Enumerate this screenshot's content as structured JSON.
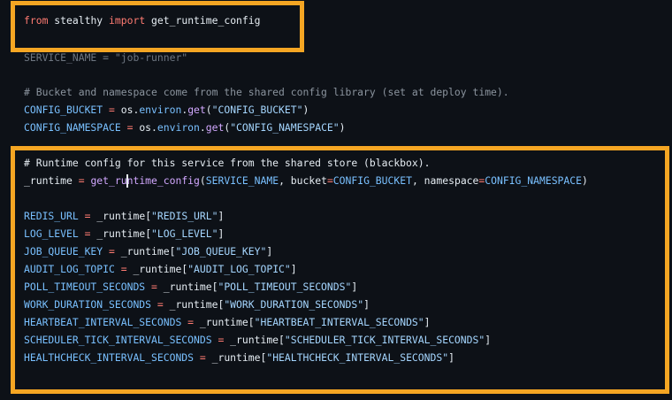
{
  "editor": {
    "import_line": {
      "kw_from": "from",
      "module": "stealthy",
      "kw_import": "import",
      "name": "get_runtime_config"
    },
    "service_line": {
      "name": "SERVICE_NAME",
      "op": "=",
      "value": "\"job-runner\""
    },
    "comment_bucket": "# Bucket and namespace come from the shared config library (set at deploy time).",
    "config_bucket_line": {
      "name": "CONFIG_BUCKET",
      "op": "=",
      "obj": "os",
      "attr": "environ",
      "method": "get",
      "arg": "\"CONFIG_BUCKET\""
    },
    "config_namespace_line": {
      "name": "CONFIG_NAMESPACE",
      "op": "=",
      "obj": "os",
      "attr": "environ",
      "method": "get",
      "arg": "\"CONFIG_NAMESPACE\""
    },
    "comment_runtime": "# Runtime config for this service from the shared store (blackbox).",
    "runtime_line": {
      "name": "_runtime",
      "op": "=",
      "func_a": "get_r",
      "func_b": "untime_config",
      "arg1": "SERVICE_NAME",
      "kw1": "bucket",
      "val1": "CONFIG_BUCKET",
      "kw2": "namespace",
      "val2": "CONFIG_NAMESPACE"
    },
    "assignments": [
      {
        "name": "REDIS_URL",
        "key": "\"REDIS_URL\""
      },
      {
        "name": "LOG_LEVEL",
        "key": "\"LOG_LEVEL\""
      },
      {
        "name": "JOB_QUEUE_KEY",
        "key": "\"JOB_QUEUE_KEY\""
      },
      {
        "name": "AUDIT_LOG_TOPIC",
        "key": "\"AUDIT_LOG_TOPIC\""
      },
      {
        "name": "POLL_TIMEOUT_SECONDS",
        "key": "\"POLL_TIMEOUT_SECONDS\""
      },
      {
        "name": "WORK_DURATION_SECONDS",
        "key": "\"WORK_DURATION_SECONDS\""
      },
      {
        "name": "HEARTBEAT_INTERVAL_SECONDS",
        "key": "\"HEARTBEAT_INTERVAL_SECONDS\""
      },
      {
        "name": "SCHEDULER_TICK_INTERVAL_SECONDS",
        "key": "\"SCHEDULER_TICK_INTERVAL_SECONDS\""
      },
      {
        "name": "HEALTHCHECK_INTERVAL_SECONDS",
        "key": "\"HEALTHCHECK_INTERVAL_SECONDS\""
      }
    ],
    "assign_op": "=",
    "runtime_ref": "_runtime"
  },
  "colors": {
    "background": "#0d1117",
    "highlight": "#f5a623",
    "keyword": "#ff7b72",
    "variable": "#79c0ff",
    "string": "#a5d6ff",
    "comment": "#8b949e"
  }
}
